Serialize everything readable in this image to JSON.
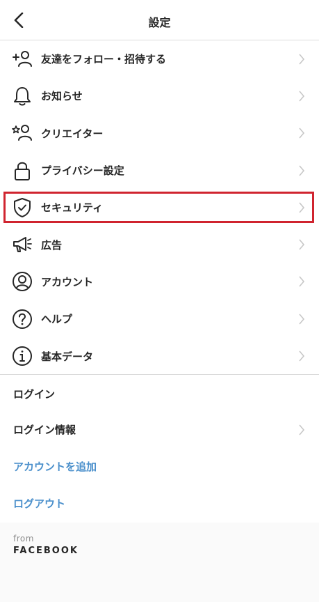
{
  "header": {
    "title": "設定",
    "back_icon": "chevron-left-icon"
  },
  "menu": [
    {
      "label": "友達をフォロー・招待する",
      "icon": "add-person-icon"
    },
    {
      "label": "お知らせ",
      "icon": "bell-icon"
    },
    {
      "label": "クリエイター",
      "icon": "creator-icon"
    },
    {
      "label": "プライバシー設定",
      "icon": "lock-icon"
    },
    {
      "label": "セキュリティ",
      "icon": "shield-icon"
    },
    {
      "label": "広告",
      "icon": "megaphone-icon"
    },
    {
      "label": "アカウント",
      "icon": "account-icon"
    },
    {
      "label": "ヘルプ",
      "icon": "help-icon"
    },
    {
      "label": "基本データ",
      "icon": "info-icon"
    }
  ],
  "login_section": {
    "header": "ログイン",
    "login_info": "ログイン情報",
    "add_account": "アカウントを追加",
    "logout": "ログアウト"
  },
  "footer": {
    "from": "from",
    "brand": "FACEBOOK"
  },
  "colors": {
    "text": "#262626",
    "link": "#4a8fcb",
    "highlight": "#d0242f",
    "divider": "#dbdbdb",
    "chevron": "#c7c7c7"
  }
}
